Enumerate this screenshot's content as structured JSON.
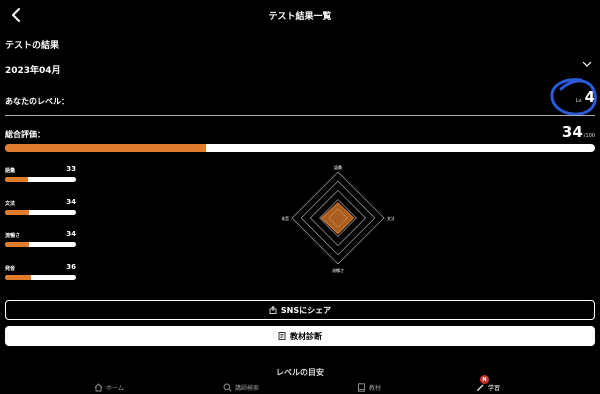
{
  "header": {
    "title": "テスト結果一覧"
  },
  "results": {
    "section_title": "テストの結果",
    "month": "2023年04月"
  },
  "level": {
    "label": "あなたのレベル：",
    "prefix": "Lv.",
    "value": "4",
    "annotation_color": "#2d5bd8"
  },
  "overall": {
    "label": "総合評価：",
    "value": "34",
    "suffix": "/100",
    "progress": 0.34
  },
  "skills": [
    {
      "label": "語彙",
      "score": "33",
      "progress": 0.33
    },
    {
      "label": "文法",
      "score": "34",
      "progress": 0.34
    },
    {
      "label": "流暢さ",
      "score": "34",
      "progress": 0.34
    },
    {
      "label": "発音",
      "score": "36",
      "progress": 0.36
    }
  ],
  "radar": {
    "axes": [
      "語彙",
      "文法",
      "流暢さ",
      "発音"
    ],
    "values": [
      33,
      34,
      34,
      36
    ],
    "max": 100,
    "rings": 5
  },
  "buttons": {
    "share": "SNSにシェア",
    "diagnosis": "教材診断"
  },
  "peek_text": "レベルの目安",
  "tabbar": {
    "items": [
      {
        "label": "ホーム",
        "icon": "home-icon"
      },
      {
        "label": "講師検索",
        "icon": "search-icon"
      },
      {
        "label": "教材",
        "icon": "book-icon"
      },
      {
        "label": "学習",
        "icon": "pen-icon",
        "badge": "N"
      }
    ]
  },
  "colors": {
    "accent": "#e07d2c",
    "background": "#000000",
    "badge": "#d0312d"
  }
}
